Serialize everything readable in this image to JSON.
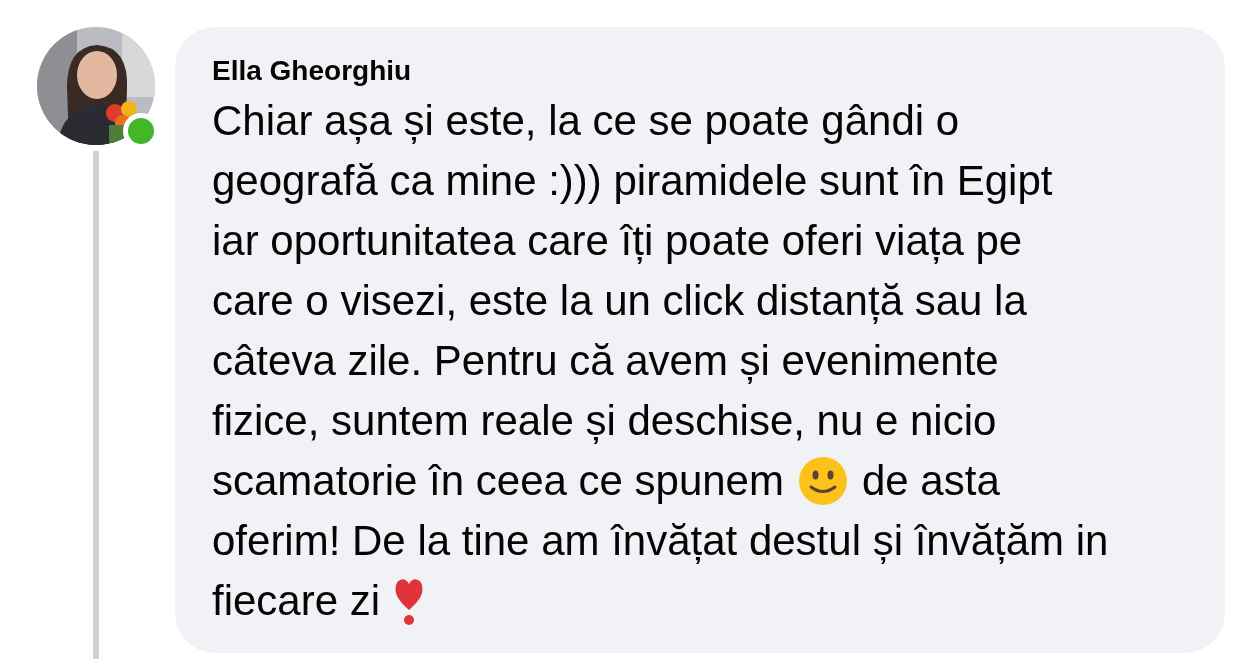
{
  "comment": {
    "author": "Ella Gheorghiu",
    "online": true,
    "lines": [
      [
        {
          "kind": "text",
          "text": "Chiar așa și este, la ce se poate gândi o"
        }
      ],
      [
        {
          "kind": "text",
          "text": "geografă ca mine :))) piramidele sunt în Egipt"
        }
      ],
      [
        {
          "kind": "text",
          "text": "iar oportunitatea care îți poate oferi viața pe"
        }
      ],
      [
        {
          "kind": "text",
          "text": "care o visezi, este la un click distanță sau la"
        }
      ],
      [
        {
          "kind": "text",
          "text": "câteva zile. Pentru că avem și evenimente"
        }
      ],
      [
        {
          "kind": "text",
          "text": "fizice, suntem reale și deschise, nu e nicio"
        }
      ],
      [
        {
          "kind": "text",
          "text": "scamatorie în ceea ce spunem"
        },
        {
          "kind": "smiley"
        },
        {
          "kind": "text",
          "text": "de asta"
        }
      ],
      [
        {
          "kind": "text",
          "text": "oferim! De la tine am învățat destul și învățăm in"
        }
      ],
      [
        {
          "kind": "text",
          "text": "fiecare zi"
        },
        {
          "kind": "heart_exclamation"
        }
      ]
    ]
  }
}
